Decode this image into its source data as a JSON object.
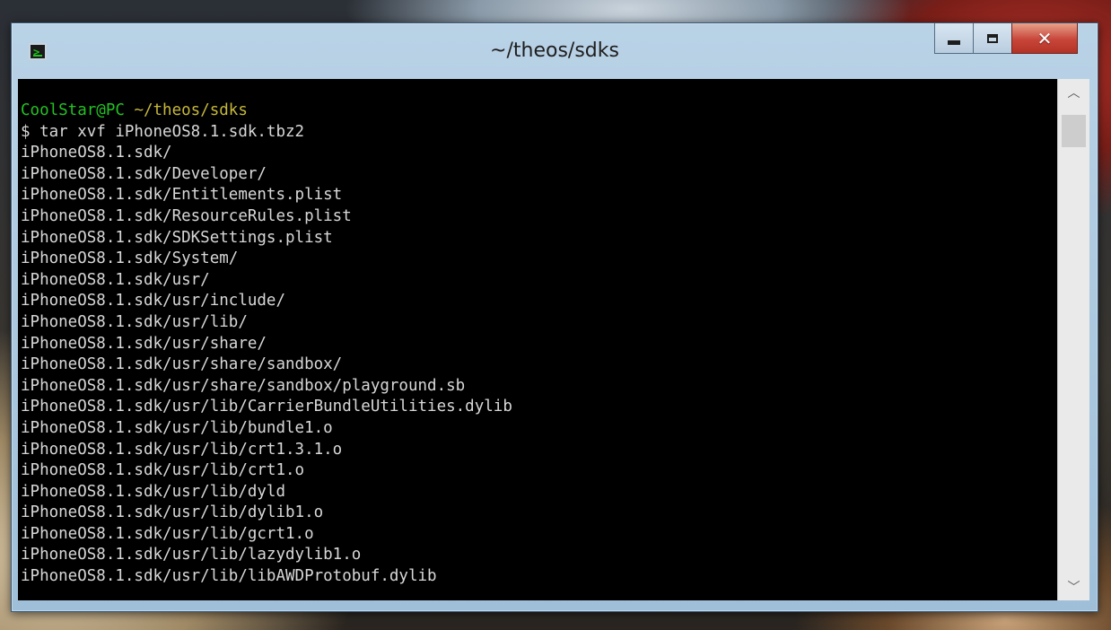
{
  "window": {
    "title": "~/theos/sdks",
    "icon": "terminal-icon",
    "controls": {
      "minimize": "minimize-icon",
      "maximize": "maximize-icon",
      "close": "close-icon"
    }
  },
  "terminal": {
    "prompt_user": "CoolStar@PC",
    "prompt_dir": "~/theos/sdks",
    "command": "$ tar xvf iPhoneOS8.1.sdk.tbz2",
    "output": [
      "iPhoneOS8.1.sdk/",
      "iPhoneOS8.1.sdk/Developer/",
      "iPhoneOS8.1.sdk/Entitlements.plist",
      "iPhoneOS8.1.sdk/ResourceRules.plist",
      "iPhoneOS8.1.sdk/SDKSettings.plist",
      "iPhoneOS8.1.sdk/System/",
      "iPhoneOS8.1.sdk/usr/",
      "iPhoneOS8.1.sdk/usr/include/",
      "iPhoneOS8.1.sdk/usr/lib/",
      "iPhoneOS8.1.sdk/usr/share/",
      "iPhoneOS8.1.sdk/usr/share/sandbox/",
      "iPhoneOS8.1.sdk/usr/share/sandbox/playground.sb",
      "iPhoneOS8.1.sdk/usr/lib/CarrierBundleUtilities.dylib",
      "iPhoneOS8.1.sdk/usr/lib/bundle1.o",
      "iPhoneOS8.1.sdk/usr/lib/crt1.3.1.o",
      "iPhoneOS8.1.sdk/usr/lib/crt1.o",
      "iPhoneOS8.1.sdk/usr/lib/dyld",
      "iPhoneOS8.1.sdk/usr/lib/dylib1.o",
      "iPhoneOS8.1.sdk/usr/lib/gcrt1.o",
      "iPhoneOS8.1.sdk/usr/lib/lazydylib1.o",
      "iPhoneOS8.1.sdk/usr/lib/libAWDProtobuf.dylib"
    ]
  },
  "scrollbar": {
    "up_icon": "chevron-up-icon",
    "down_icon": "chevron-down-icon"
  },
  "colors": {
    "prompt_user": "#23c223",
    "prompt_dir": "#c6b83a",
    "text": "#d8d8d8",
    "background": "#000000"
  }
}
